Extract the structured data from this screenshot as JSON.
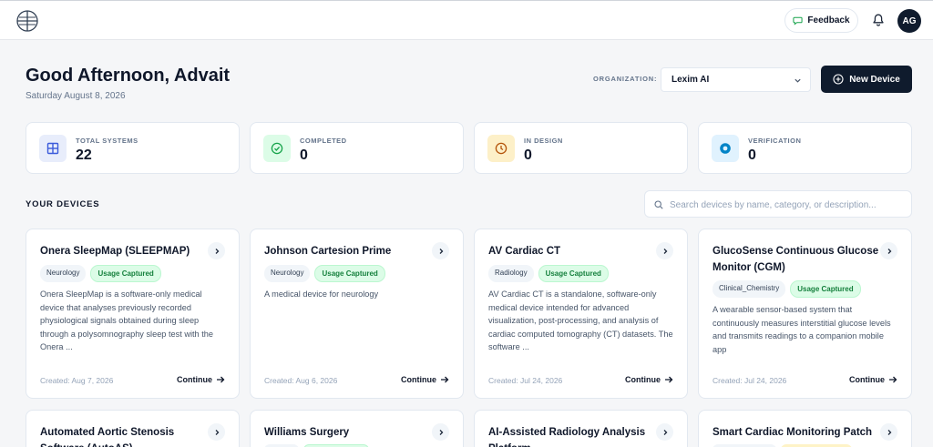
{
  "header": {
    "feedback_label": "Feedback",
    "avatar_initials": "AG"
  },
  "greeting": {
    "title": "Good Afternoon, Advait",
    "date": "Saturday August 8, 2026"
  },
  "organization": {
    "label": "ORGANIZATION:",
    "selected": "Lexim AI"
  },
  "actions": {
    "new_device_label": "New Device"
  },
  "stats": [
    {
      "label": "TOTAL SYSTEMS",
      "value": "22",
      "icon": "grid-icon",
      "color": "#3b5bdb"
    },
    {
      "label": "COMPLETED",
      "value": "0",
      "icon": "check-circle-icon",
      "color": "#16a34a"
    },
    {
      "label": "IN DESIGN",
      "value": "0",
      "icon": "clock-icon",
      "color": "#b45309"
    },
    {
      "label": "VERIFICATION",
      "value": "0",
      "icon": "target-icon",
      "color": "#0284c7"
    }
  ],
  "devices_section": {
    "title": "YOUR DEVICES",
    "search_placeholder": "Search devices by name, category, or description..."
  },
  "devices": [
    {
      "title": "Onera SleepMap (SLEEPMAP)",
      "category": "Neurology",
      "status": "Usage Captured",
      "description": "Onera SleepMap is a software-only medical device that analyses previously recorded physiological signals obtained during sleep through a polysomnography sleep test with the Onera ...",
      "created": "Created: Aug 7, 2026",
      "action": "Continue"
    },
    {
      "title": "Johnson Cartesion Prime",
      "category": "Neurology",
      "status": "Usage Captured",
      "description": "A medical device for neurology",
      "created": "Created: Aug 6, 2026",
      "action": "Continue"
    },
    {
      "title": "AV Cardiac CT",
      "category": "Radiology",
      "status": "Usage Captured",
      "description": "AV Cardiac CT is a standalone, software-only medical device intended for advanced visualization, post-processing, and analysis of cardiac computed tomography (CT) datasets. The software ...",
      "created": "Created: Jul 24, 2026",
      "action": "Continue"
    },
    {
      "title": "GlucoSense Continuous Glucose Monitor (CGM)",
      "category": "Clinical_Chemistry",
      "status": "Usage Captured",
      "description": "A wearable sensor-based system that continuously measures interstitial glucose levels and transmits readings to a companion mobile app",
      "created": "Created: Jul 24, 2026",
      "action": "Continue"
    },
    {
      "title": "Automated Aortic Stenosis Software (AutoAS)"
    },
    {
      "title": "Williams Surgery"
    },
    {
      "title": "AI-Assisted Radiology Analysis Platform"
    },
    {
      "title": "Smart Cardiac Monitoring Patch"
    }
  ]
}
